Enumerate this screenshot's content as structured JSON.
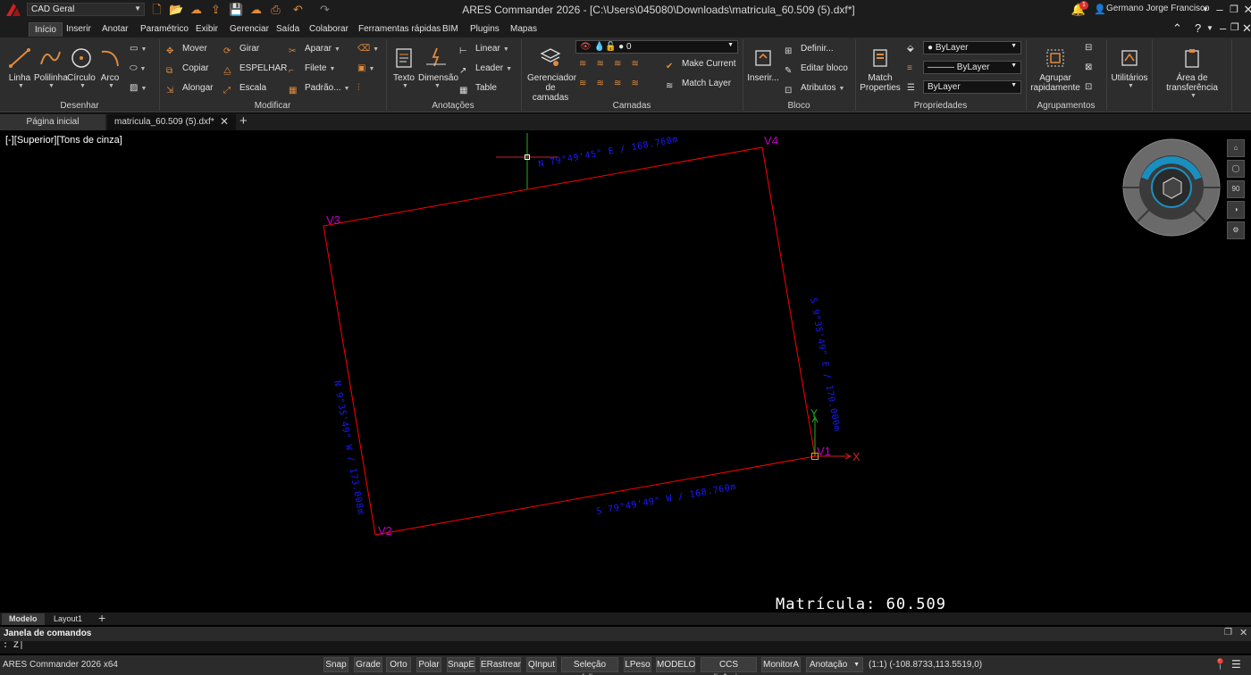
{
  "workspace": "CAD Geral",
  "app_title": "ARES Commander 2026 - [C:\\Users\\045080\\Downloads\\matricula_60.509 (5).dxf*]",
  "user_name": "Germano Jorge Francisco",
  "notification_count": "1",
  "menu_tabs": [
    "Início",
    "Inserir",
    "Anotar",
    "Paramétrico",
    "Exibir",
    "Gerenciar",
    "Saída",
    "Colaborar",
    "Ferramentas rápidas",
    "BIM",
    "Plugins",
    "Mapas"
  ],
  "ribbon": {
    "desenhar": {
      "title": "Desenhar",
      "linha": "Linha",
      "polilinha": "Polilinha",
      "circulo": "Círculo",
      "arco": "Arco"
    },
    "modificar": {
      "title": "Modificar",
      "mover": "Mover",
      "girar": "Girar",
      "aparar": "Aparar",
      "copiar": "Copiar",
      "espelhar": "ESPELHAR",
      "filete": "Filete",
      "alongar": "Alongar",
      "escala": "Escala",
      "padrao": "Padrão..."
    },
    "anotacoes": {
      "title": "Anotações",
      "texto": "Texto",
      "dimensao": "Dimensão",
      "linear": "Linear",
      "leader": "Leader",
      "table": "Table"
    },
    "camadas": {
      "title": "Camadas",
      "gerenciador_l1": "Gerenciador",
      "gerenciador_l2": "de camadas",
      "layer_value": "0",
      "make_current": "Make Current",
      "match_layer": "Match Layer"
    },
    "bloco": {
      "title": "Bloco",
      "inserir": "Inserir...",
      "definir": "Definir...",
      "editar": "Editar bloco",
      "atributos": "Atributos"
    },
    "propriedades": {
      "title": "Propriedades",
      "match_l1": "Match",
      "match_l2": "Properties",
      "color": "ByLayer",
      "linetype": "ByLayer",
      "lineweight": "ByLayer"
    },
    "agrupamentos": {
      "title": "Agrupamentos",
      "agrupar_l1": "Agrupar",
      "agrupar_l2": "rapidamente"
    },
    "utilitarios": "Utilitários",
    "transferencia": "Área de transferência"
  },
  "doc_tabs": {
    "home": "Página inicial",
    "active": "matricula_60.509 (5).dxf*"
  },
  "view_label": "[-][Superior][Tons de cinza]",
  "drawing": {
    "vertices": [
      "V1",
      "V2",
      "V3",
      "V4"
    ],
    "bearings": {
      "top": "N 79°49'45\" E / 168.768m",
      "right": "S 9°35'49\" E / 170.000m",
      "bottom": "S 79°49'49\" W / 168.760m",
      "left": "N 9°35'49\" W / 173.008m"
    },
    "title": "Matrícula: 60.509",
    "ucs_x": "X",
    "ucs_y": "Y",
    "colors": {
      "boundary": "#ff0000",
      "vertex_labels": "#c000c0",
      "bearings": "#1a1aff",
      "title": "#ffffff"
    }
  },
  "nav_tools": [
    "home-view",
    "orbit",
    "90",
    "pan",
    "settings"
  ],
  "layout_tabs": [
    "Modelo",
    "Layout1"
  ],
  "command_window": {
    "title": "Janela de comandos",
    "input": ": Z|"
  },
  "status": {
    "app_version": "ARES Commander 2026 x64",
    "buttons": [
      "Snap",
      "Grade",
      "Orto",
      "Polar",
      "SnapE",
      "ERastrear",
      "QInput",
      "Seleção cíclica",
      "LPeso",
      "MODELO",
      "CCS dinâmico",
      "MonitorA",
      "Anotação"
    ],
    "scale": "(1:1)",
    "coordinates": "(-108.8733,113.5519,0)"
  }
}
